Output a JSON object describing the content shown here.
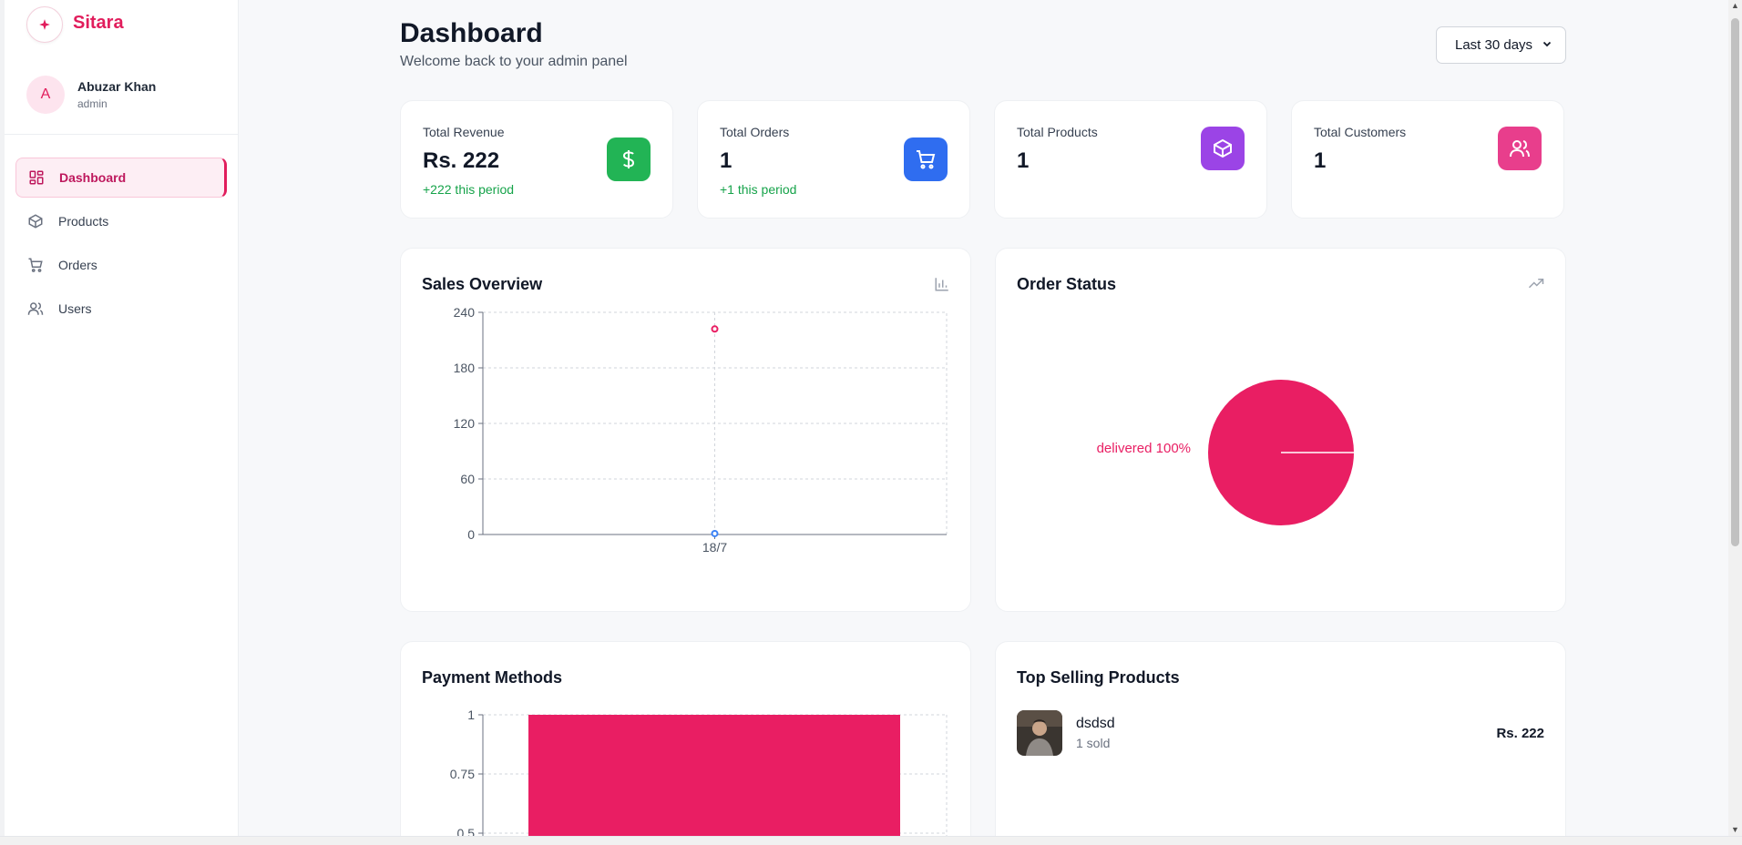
{
  "brand": {
    "name": "Sitara",
    "icon": "star-icon"
  },
  "user": {
    "initial": "A",
    "name": "Abuzar Khan",
    "role": "admin"
  },
  "nav": [
    {
      "label": "Dashboard",
      "icon": "dashboard-grid-icon",
      "active": true
    },
    {
      "label": "Products",
      "icon": "box-icon",
      "active": false
    },
    {
      "label": "Orders",
      "icon": "cart-icon",
      "active": false
    },
    {
      "label": "Users",
      "icon": "users-icon",
      "active": false
    }
  ],
  "header": {
    "title": "Dashboard",
    "subtitle": "Welcome back to your admin panel",
    "period": "Last 30 days"
  },
  "stats": [
    {
      "label": "Total Revenue",
      "value": "Rs. 222",
      "change": "+222 this period",
      "icon": "dollar-icon",
      "color": "#22b455"
    },
    {
      "label": "Total Orders",
      "value": "1",
      "change": "+1 this period",
      "icon": "cart-icon",
      "color": "#2f6df0"
    },
    {
      "label": "Total Products",
      "value": "1",
      "change": "",
      "icon": "box-icon",
      "color": "#9b44e6"
    },
    {
      "label": "Total Customers",
      "value": "1",
      "change": "",
      "icon": "users-icon",
      "color": "#e83e8c"
    }
  ],
  "panels": {
    "sales": {
      "title": "Sales Overview",
      "icon": "bar-chart-icon"
    },
    "status": {
      "title": "Order Status",
      "icon": "trending-up-icon"
    },
    "payment": {
      "title": "Payment Methods"
    },
    "top": {
      "title": "Top Selling Products"
    }
  },
  "top_products": [
    {
      "name": "dsdsd",
      "sold": "1 sold",
      "price": "Rs. 222"
    }
  ],
  "colors": {
    "accent": "#e91e63",
    "blue_series": "#3b82f6",
    "grid": "#d1d5db"
  },
  "chart_data": [
    {
      "type": "line",
      "categories": [
        "18/7"
      ],
      "series": [
        {
          "values": [
            222
          ],
          "color": "#e91e63"
        },
        {
          "values": [
            1
          ],
          "color": "#3b82f6"
        }
      ],
      "ylim": [
        0,
        240
      ],
      "yticks": [
        "240",
        "180",
        "120",
        "60",
        "0"
      ],
      "grid": true
    },
    {
      "type": "pie",
      "slices": [
        {
          "label": "delivered 100%",
          "value": 100,
          "color": "#e91e63"
        }
      ]
    },
    {
      "type": "bar",
      "values": [
        1
      ],
      "ylim_visible": [
        0.5,
        1
      ],
      "yticks": [
        "1",
        "0.75",
        "0.5"
      ],
      "color": "#e91e63",
      "grid": true
    }
  ]
}
